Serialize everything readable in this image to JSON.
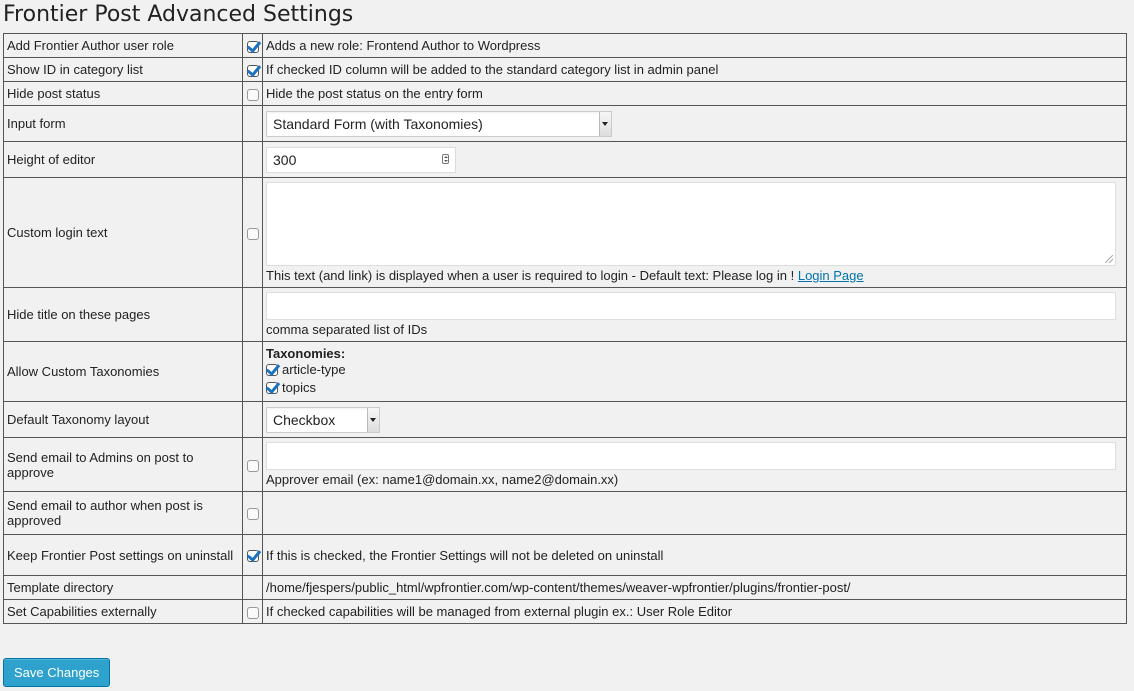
{
  "page": {
    "title": "Frontier Post Advanced Settings"
  },
  "rows": {
    "author_role": {
      "label": "Add Frontier Author user role",
      "checked": true,
      "desc": "Adds a new role: Frontend Author to Wordpress"
    },
    "show_id": {
      "label": "Show ID in category list",
      "checked": true,
      "desc": "If checked ID column will be added to the standard category list in admin panel"
    },
    "hide_status": {
      "label": "Hide post status",
      "checked": false,
      "desc": "Hide the post status on the entry form"
    },
    "input_form": {
      "label": "Input form",
      "selected": "Standard Form (with Taxonomies)"
    },
    "editor_height": {
      "label": "Height of editor",
      "value": "300"
    },
    "login_text": {
      "label": "Custom login text",
      "checked": false,
      "value": "",
      "desc": "This text (and link) is displayed when a user is required to login - Default text: Please log in !",
      "link": "Login Page"
    },
    "hide_title": {
      "label": "Hide title on these pages",
      "value": "",
      "desc": "comma separated list of IDs"
    },
    "custom_tax": {
      "label": "Allow Custom Taxonomies",
      "heading": "Taxonomies:",
      "items": [
        {
          "label": "article-type",
          "checked": true
        },
        {
          "label": "topics",
          "checked": true
        }
      ]
    },
    "tax_layout": {
      "label": "Default Taxonomy layout",
      "selected": "Checkbox"
    },
    "email_admins": {
      "label": "Send email to Admins on post to approve",
      "checked": false,
      "value": "",
      "desc": "Approver email (ex: name1@domain.xx, name2@domain.xx)"
    },
    "email_author": {
      "label": "Send email to author when post is approved",
      "checked": false
    },
    "keep_settings": {
      "label": "Keep Frontier Post settings on uninstall",
      "checked": true,
      "desc": "If this is checked, the Frontier Settings will not be deleted on uninstall"
    },
    "template_dir": {
      "label": "Template directory",
      "value": "/home/fjespers/public_html/wpfrontier.com/wp-content/themes/weaver-wpfrontier/plugins/frontier-post/"
    },
    "capabilities": {
      "label": "Set Capabilities externally",
      "checked": false,
      "desc": "If checked capabilities will be managed from external plugin ex.: User Role Editor"
    }
  },
  "buttons": {
    "save": "Save Changes"
  },
  "colors": {
    "accent": "#2ea2cc",
    "check": "#1e73be",
    "link": "#0073aa"
  }
}
